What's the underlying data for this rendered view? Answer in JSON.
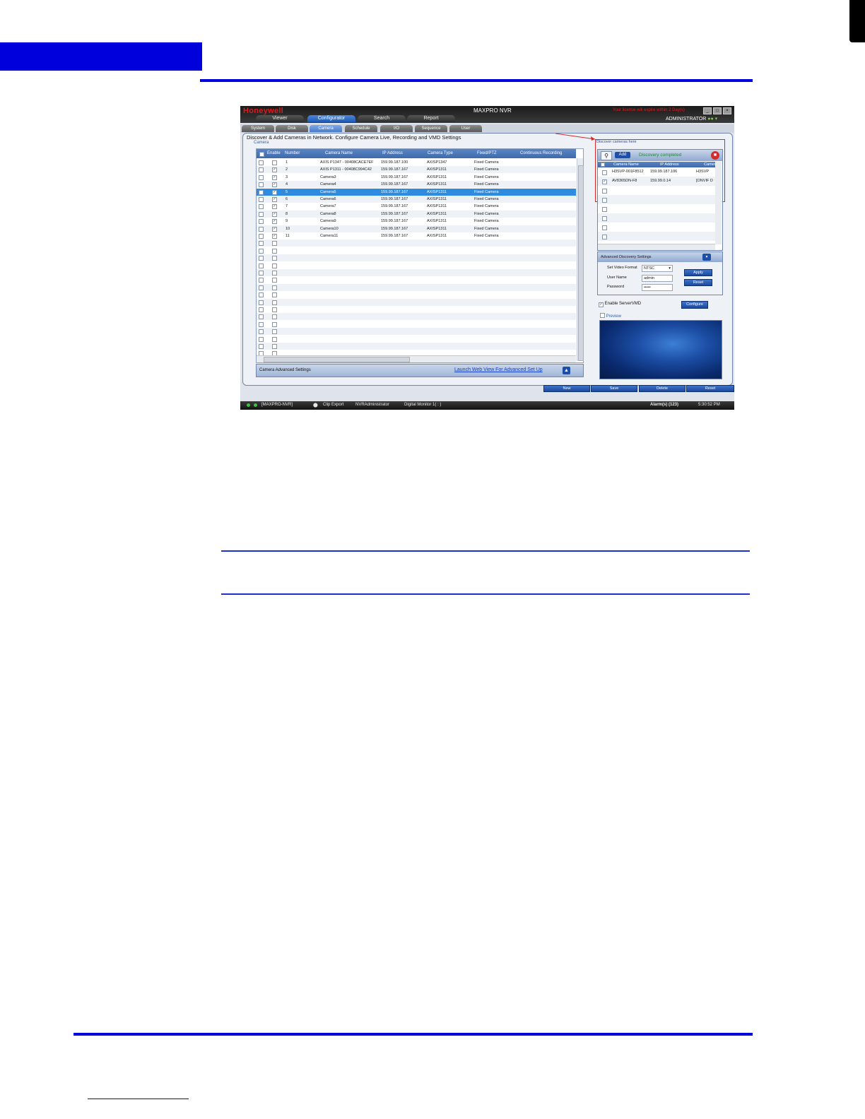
{
  "app": {
    "logo": "Honeywell",
    "title": "MAXPRO NVR",
    "license_warning": "Your license will expire within 2 Day(s)",
    "user": "ADMINISTRATOR",
    "window_controls": [
      "_",
      "□",
      "×"
    ],
    "main_tabs": [
      "Viewer",
      "Configurator",
      "Search",
      "Report"
    ],
    "active_main_tab": "Configurator",
    "sub_tabs": [
      "System",
      "Disk",
      "Camera",
      "Schedule",
      "I/O",
      "Sequence",
      "User"
    ],
    "active_sub_tab": "Camera"
  },
  "camera_page": {
    "heading": "Discover & Add Cameras in Network. Configure Camera Live, Recording and VMD Settings",
    "group_label": "Camera",
    "columns": [
      "Enable",
      "Number",
      "Camera Name",
      "IP Address",
      "Camera Type",
      "Fixed/PTZ",
      "Continuous Recording"
    ],
    "rows": [
      {
        "enabled": false,
        "number": "1",
        "name": "AXIS P1347 - 00408CACE7EF",
        "ip": "159.99.187.100",
        "type": "AXISP1347",
        "ptz": "Fixed Camera"
      },
      {
        "enabled": true,
        "number": "2",
        "name": "AXIS P1311 - 00408C994C42",
        "ip": "159.99.187.167",
        "type": "AXISP1311",
        "ptz": "Fixed Camera"
      },
      {
        "enabled": true,
        "number": "3",
        "name": "Camera3",
        "ip": "159.99.187.167",
        "type": "AXISP1311",
        "ptz": "Fixed Camera"
      },
      {
        "enabled": true,
        "number": "4",
        "name": "Camera4",
        "ip": "159.99.187.167",
        "type": "AXISP1311",
        "ptz": "Fixed Camera"
      },
      {
        "enabled": true,
        "number": "5",
        "name": "Camera5",
        "ip": "159.99.187.167",
        "type": "AXISP1311",
        "ptz": "Fixed Camera",
        "selected": true
      },
      {
        "enabled": true,
        "number": "6",
        "name": "Camera6",
        "ip": "159.99.187.167",
        "type": "AXISP1311",
        "ptz": "Fixed Camera"
      },
      {
        "enabled": true,
        "number": "7",
        "name": "Camera7",
        "ip": "159.99.187.167",
        "type": "AXISP1311",
        "ptz": "Fixed Camera"
      },
      {
        "enabled": true,
        "number": "8",
        "name": "Camera8",
        "ip": "159.99.187.167",
        "type": "AXISP1311",
        "ptz": "Fixed Camera"
      },
      {
        "enabled": true,
        "number": "9",
        "name": "Camera9",
        "ip": "159.99.187.167",
        "type": "AXISP1311",
        "ptz": "Fixed Camera"
      },
      {
        "enabled": true,
        "number": "10",
        "name": "Camera10",
        "ip": "159.99.187.167",
        "type": "AXISP1311",
        "ptz": "Fixed Camera"
      },
      {
        "enabled": true,
        "number": "11",
        "name": "Camera11",
        "ip": "159.99.187.167",
        "type": "AXISP1311",
        "ptz": "Fixed Camera"
      }
    ],
    "advanced_settings_label": "Camera Advanced Settings",
    "launch_link": "Launch Web View For Advanced Set Up"
  },
  "discovery": {
    "callout": "Discover cameras here",
    "add_label": "Add",
    "status": "Discovery completed",
    "columns": [
      "Camera Name",
      "IP Address",
      "Camera"
    ],
    "rows": [
      {
        "checked": false,
        "name": "H3SVP-001F8512",
        "ip": "159.99.187.106",
        "type": "H3SVP"
      },
      {
        "checked": true,
        "name": "AV8365DN-F8",
        "ip": "159.99.0.14",
        "type": "[ONVIF D"
      }
    ]
  },
  "advanced_discovery": {
    "title": "Advanced Discovery Settings",
    "video_format_label": "Set Video Format",
    "video_format_value": "NTSC",
    "user_label": "User Name",
    "user_value": "admin",
    "password_label": "Password",
    "password_value": "•••••",
    "apply_label": "Apply",
    "reset_label": "Reset"
  },
  "vmd": {
    "enable_label": "Enable ServerVMD",
    "enabled": true,
    "configure_label": "Configure",
    "preview_label": "Preview"
  },
  "actions": [
    "New",
    "Save",
    "Delete",
    "Reset"
  ],
  "status_bar": {
    "server": "[MAXPRO-NVR]",
    "clip_export": "Clip Export",
    "user": "NVRAdministrator",
    "monitor": "Digital Monitor 1( : )",
    "alarms": "Alarm(s) (123)",
    "time": "5:30:52 PM"
  }
}
